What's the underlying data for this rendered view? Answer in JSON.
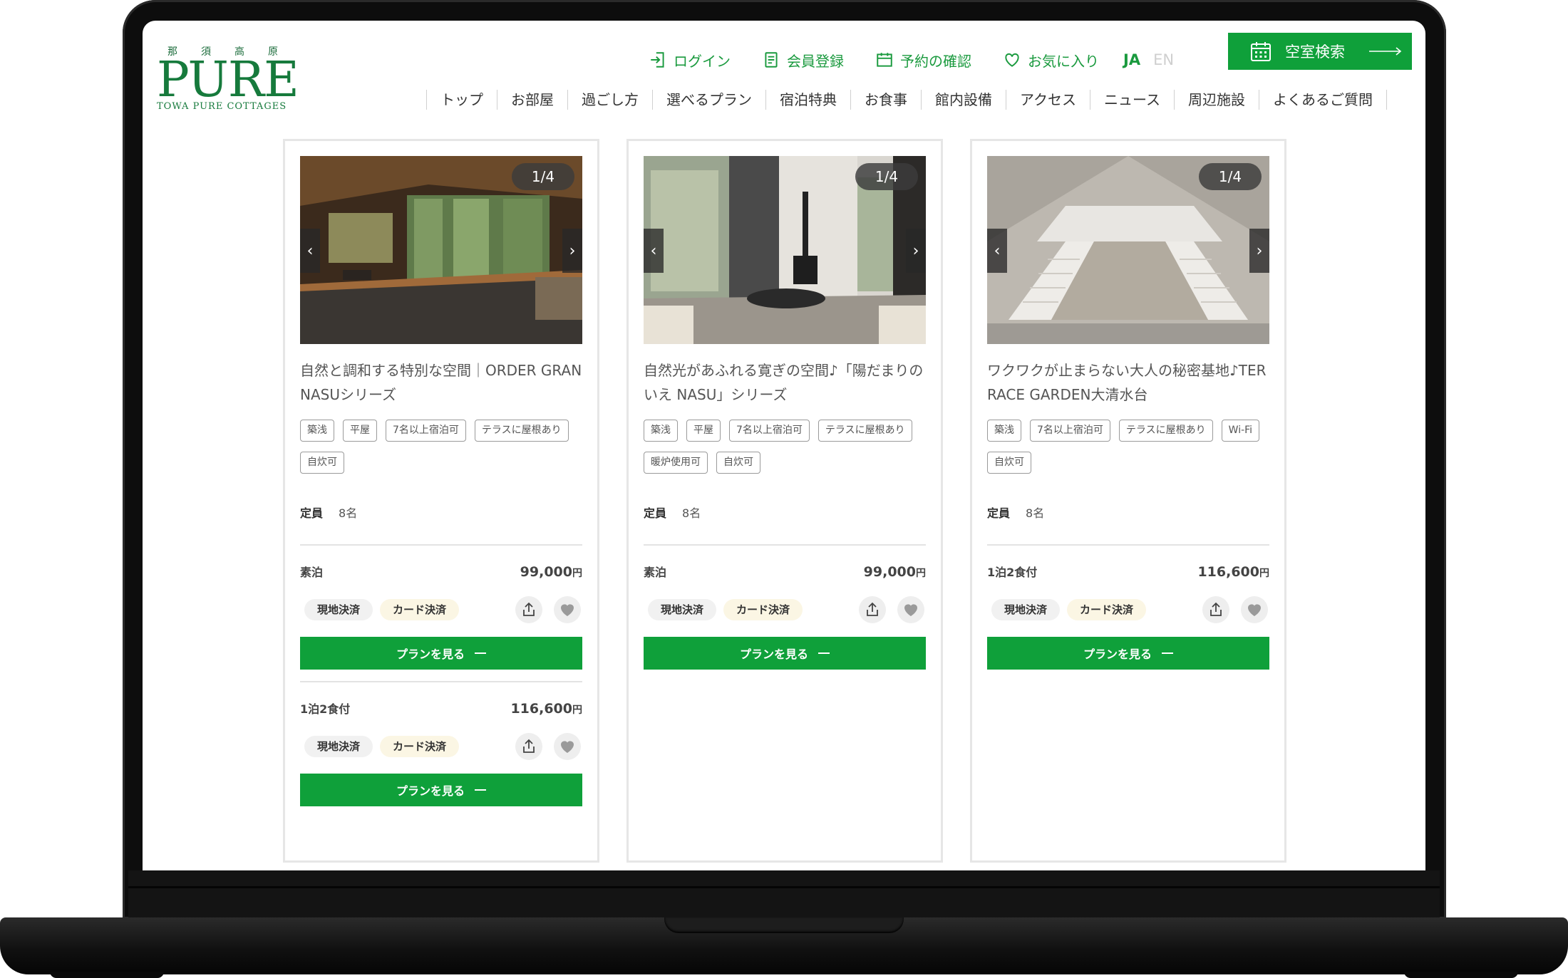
{
  "logo": {
    "kana": [
      "那",
      "須",
      "高",
      "原"
    ],
    "main": "PURE",
    "sub": "TOWA PURE COTTAGES"
  },
  "util_nav": [
    {
      "label": "ログイン",
      "icon": "login-icon"
    },
    {
      "label": "会員登録",
      "icon": "member-register-icon"
    },
    {
      "label": "予約の確認",
      "icon": "calendar-icon"
    },
    {
      "label": "お気に入り",
      "icon": "heart-icon"
    }
  ],
  "lang": {
    "ja": "JA",
    "en": "EN"
  },
  "search_button": {
    "label": "空室検索"
  },
  "main_nav": [
    "トップ",
    "お部屋",
    "過ごし方",
    "選べるプラン",
    "宿泊特典",
    "お食事",
    "館内設備",
    "アクセス",
    "ニュース",
    "周辺施設",
    "よくあるご質問"
  ],
  "accent_color": "#0fa03a",
  "cards": [
    {
      "counter": "1/4",
      "title": "自然と調和する特別な空間｜ORDER GRAN NASUシリーズ",
      "tags": [
        "築浅",
        "平屋",
        "7名以上宿泊可",
        "テラスに屋根あり",
        "自炊可"
      ],
      "capacity_label": "定員",
      "capacity_value": "8名",
      "plans": [
        {
          "name": "素泊",
          "price": "99,000",
          "unit": "円",
          "pay": [
            "現地決済",
            "カード決済"
          ],
          "button": "プランを見る"
        },
        {
          "name": "1泊2食付",
          "price": "116,600",
          "unit": "円",
          "pay": [
            "現地決済",
            "カード決済"
          ],
          "button": "プランを見る"
        }
      ]
    },
    {
      "counter": "1/4",
      "title": "自然光があふれる寛ぎの空間♪「陽だまりのいえ NASU」シリーズ",
      "tags": [
        "築浅",
        "平屋",
        "7名以上宿泊可",
        "テラスに屋根あり",
        "暖炉使用可",
        "自炊可"
      ],
      "capacity_label": "定員",
      "capacity_value": "8名",
      "plans": [
        {
          "name": "素泊",
          "price": "99,000",
          "unit": "円",
          "pay": [
            "現地決済",
            "カード決済"
          ],
          "button": "プランを見る"
        }
      ]
    },
    {
      "counter": "1/4",
      "title": "ワクワクが止まらない大人の秘密基地♪TERRACE GARDEN大清水台",
      "tags": [
        "築浅",
        "7名以上宿泊可",
        "テラスに屋根あり",
        "Wi-Fi",
        "自炊可"
      ],
      "capacity_label": "定員",
      "capacity_value": "8名",
      "plans": [
        {
          "name": "1泊2食付",
          "price": "116,600",
          "unit": "円",
          "pay": [
            "現地決済",
            "カード決済"
          ],
          "button": "プランを見る"
        }
      ]
    }
  ]
}
